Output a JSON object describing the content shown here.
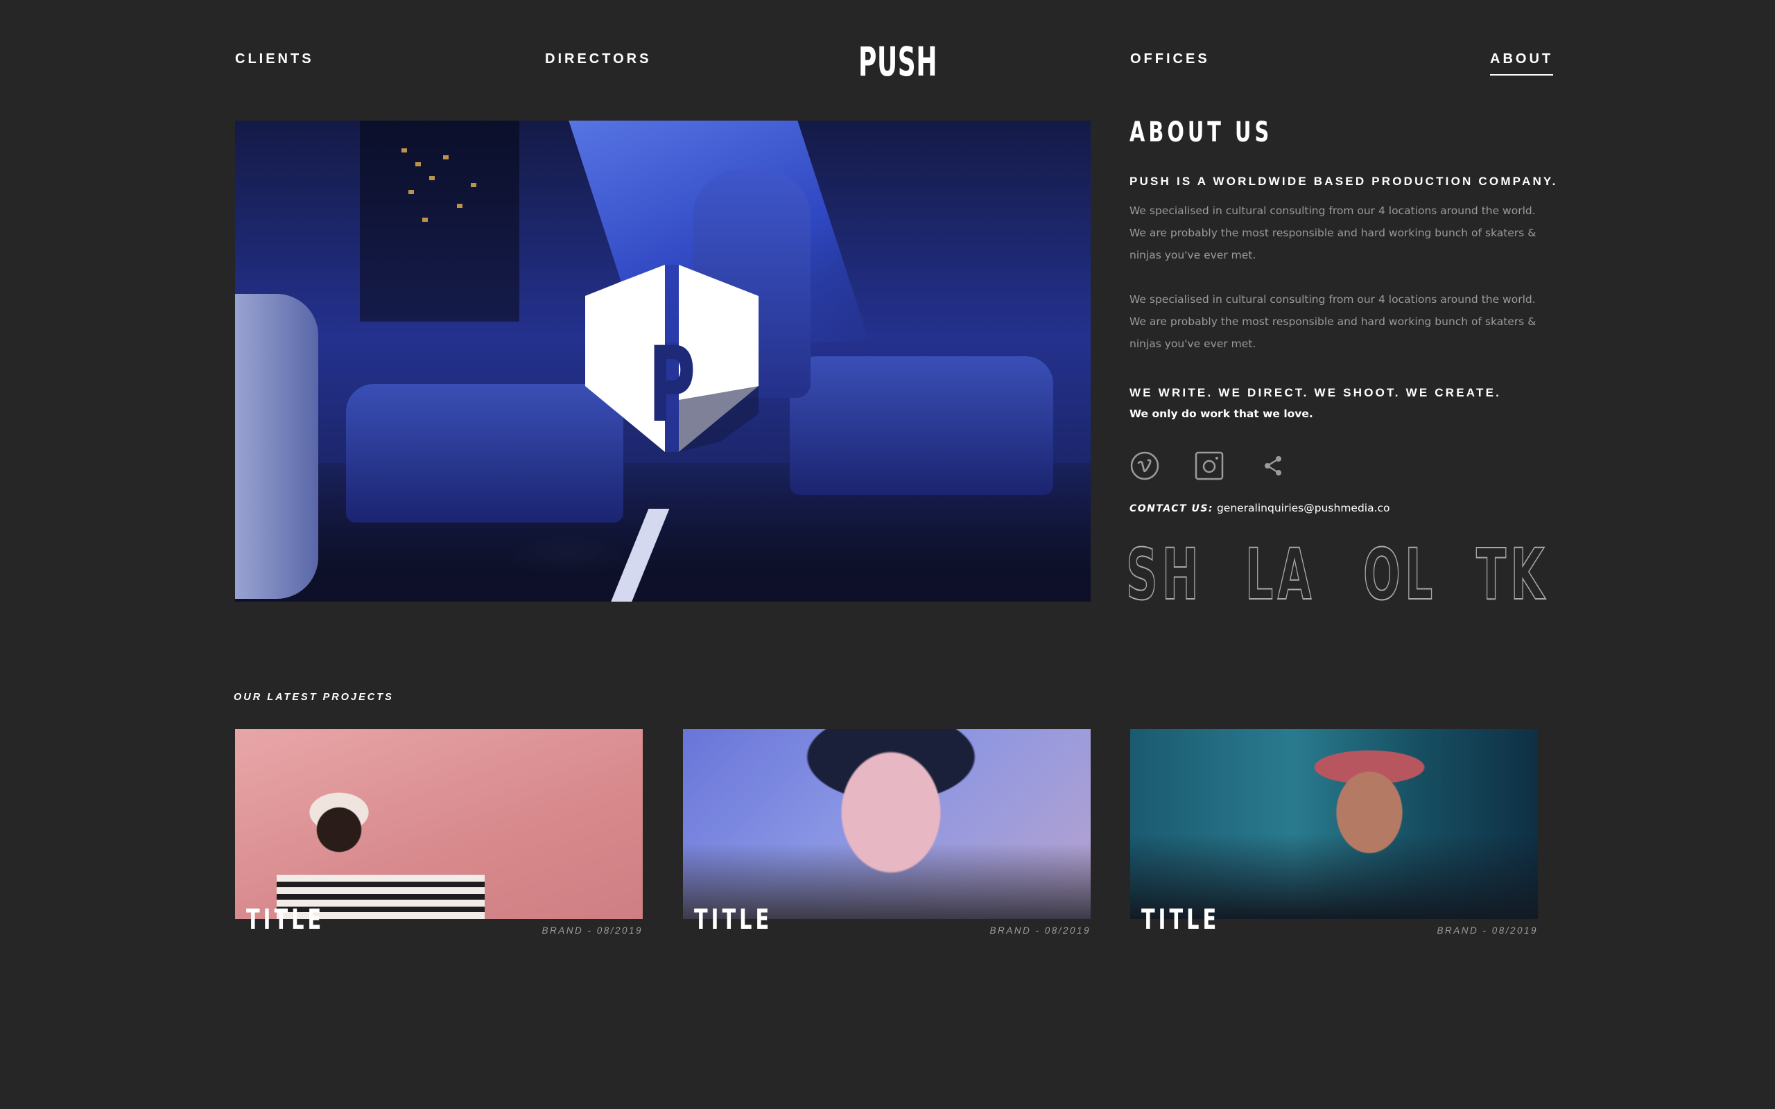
{
  "nav": {
    "clients": "CLIENTS",
    "directors": "DIRECTORS",
    "logo": "PUSH",
    "offices": "OFFICES",
    "about": "ABOUT"
  },
  "hero": {
    "logo_letter": "P"
  },
  "about": {
    "title": "ABOUT US",
    "tagline": "PUSH IS A WORLDWIDE BASED PRODUCTION COMPANY.",
    "paragraphs": [
      "We specialised in cultural consulting from our 4 locations around the world. We are probably the most responsible and hard working bunch of skaters & ninjas you've ever met.",
      "We specialised in cultural consulting from our 4 locations around the world. We are probably the most responsible and hard working bunch of skaters & ninjas you've ever met."
    ],
    "motto": "WE WRITE. WE DIRECT. WE SHOOT. WE CREATE.",
    "motto_sub": "We only do work that we love.",
    "social_icons": [
      "vimeo-icon",
      "instagram-icon",
      "share-icon"
    ],
    "contact_label": "CONTACT US:",
    "contact_email": "generalinquiries@pushmedia.co",
    "office_codes": [
      "SH",
      "LA",
      "OL",
      "TK"
    ]
  },
  "projects": {
    "heading": "OUR LATEST PROJECTS",
    "items": [
      {
        "title": "TITLE",
        "meta": "BRAND - 08/2019"
      },
      {
        "title": "TITLE",
        "meta": "BRAND - 08/2019"
      },
      {
        "title": "TITLE",
        "meta": "BRAND - 08/2019"
      }
    ]
  },
  "colors": {
    "background": "#262626",
    "text": "#ffffff",
    "muted": "#9b9b9b",
    "outline": "#a9a9a9"
  }
}
